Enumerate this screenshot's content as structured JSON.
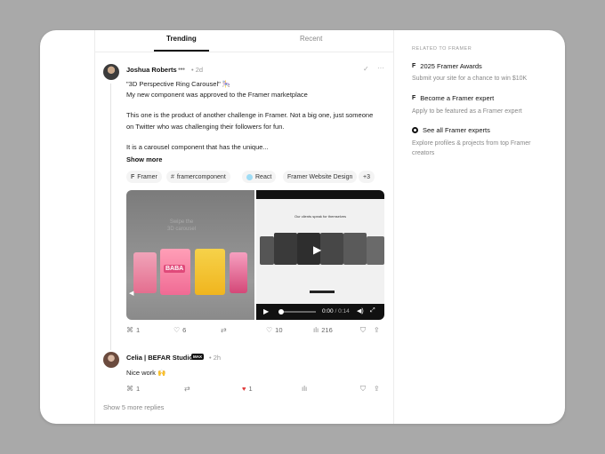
{
  "tabs": {
    "trending": "Trending",
    "recent": "Recent"
  },
  "post": {
    "author": "Joshua Roberts",
    "time": "• 2d",
    "lines": [
      "\"3D Perspective Ring Carousel\" 🎠",
      "My new component was approved to the Framer marketplace",
      "This one is the product of another challenge in Framer. Not a big one, just someone",
      "on Twitter who was challenging their followers for fun.",
      "It is a carousel component that has the unique..."
    ],
    "show_more": "Show more",
    "tags": [
      {
        "label": "Framer",
        "icon": "framer-icon"
      },
      {
        "label": "framercomponent",
        "icon": "hash-icon"
      },
      {
        "label": "React",
        "icon": "react-icon"
      },
      {
        "label": "Framer Website Design"
      },
      {
        "label": "+3"
      }
    ],
    "media_left_text": "Swipe the\n3D carousel",
    "media_left_card_text": "BABA",
    "video": {
      "caption": "Our clients speak for themselves",
      "time_current": "0:00",
      "time_total": "/ 0:14"
    },
    "actions": {
      "replies": "1",
      "likes_hearts": "6",
      "likes": "10",
      "views": "216"
    }
  },
  "reply": {
    "author": "Celia | BEFAR Studio",
    "badge": "MAX",
    "time": "• 2h",
    "text": "Nice work 🙌",
    "actions": {
      "replies": "1",
      "likes": "1"
    }
  },
  "show_replies": "Show 5 more replies",
  "sidebar": {
    "heading": "RELATED TO FRAMER",
    "items": [
      {
        "title": "2025 Framer Awards",
        "sub": "Submit your site for a chance to win $10K"
      },
      {
        "title": "Become a Framer expert",
        "sub": "Apply to be featured as a Framer expert"
      },
      {
        "title": "See all Framer experts",
        "sub": "Explore profiles & projects from top Framer creators"
      }
    ]
  },
  "colors": {
    "background": "#a9a9a9",
    "heart": "#e03a3a"
  }
}
